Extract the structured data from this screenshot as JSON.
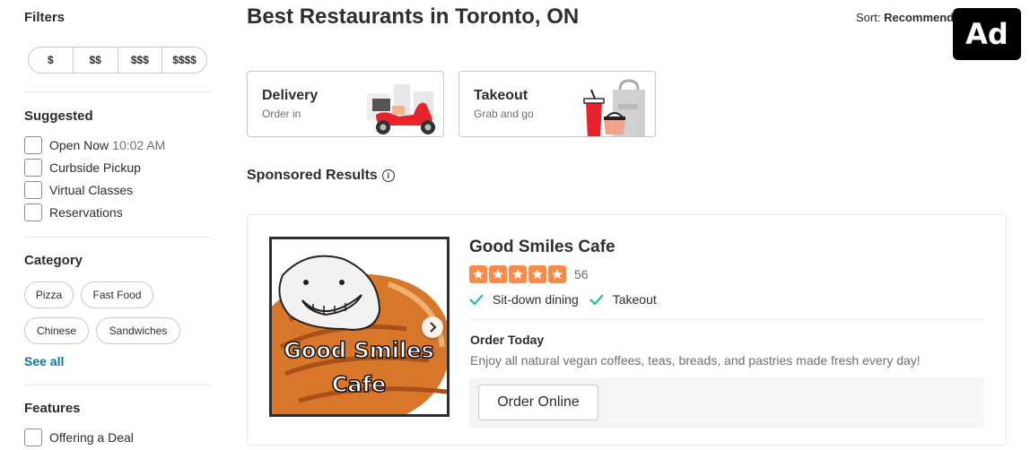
{
  "sidebar": {
    "filters_title": "Filters",
    "prices": [
      "$",
      "$$",
      "$$$",
      "$$$$"
    ],
    "suggested_title": "Suggested",
    "suggested": [
      {
        "label": "Open Now",
        "extra": "10:02 AM"
      },
      {
        "label": "Curbside Pickup",
        "extra": ""
      },
      {
        "label": "Virtual Classes",
        "extra": ""
      },
      {
        "label": "Reservations",
        "extra": ""
      }
    ],
    "category_title": "Category",
    "categories": [
      "Pizza",
      "Fast Food",
      "Chinese",
      "Sandwiches"
    ],
    "see_all": "See all",
    "features_title": "Features",
    "features": [
      {
        "label": "Offering a Deal"
      }
    ]
  },
  "header": {
    "title": "Best Restaurants in Toronto, ON",
    "sort_label": "Sort:",
    "sort_value": "Recommended",
    "ad_badge": "Ad"
  },
  "modes": [
    {
      "title": "Delivery",
      "subtitle": "Order in",
      "icon": "delivery-scooter-icon"
    },
    {
      "title": "Takeout",
      "subtitle": "Grab and go",
      "icon": "takeout-bag-icon"
    }
  ],
  "sponsored_label": "Sponsored Results",
  "business": {
    "name": "Good Smiles Cafe",
    "rating": 5,
    "review_count": "56",
    "photo_caption_line1": "Good Smiles",
    "photo_caption_line2": "Cafe",
    "amenities": [
      "Sit-down dining",
      "Takeout"
    ],
    "order_title": "Order Today",
    "order_desc": "Enjoy all natural vegan coffees, teas, breads, and pastries made fresh every day!",
    "order_button": "Order Online"
  },
  "colors": {
    "star": "#fe8a45",
    "check": "#04c585",
    "link": "#027a97"
  }
}
